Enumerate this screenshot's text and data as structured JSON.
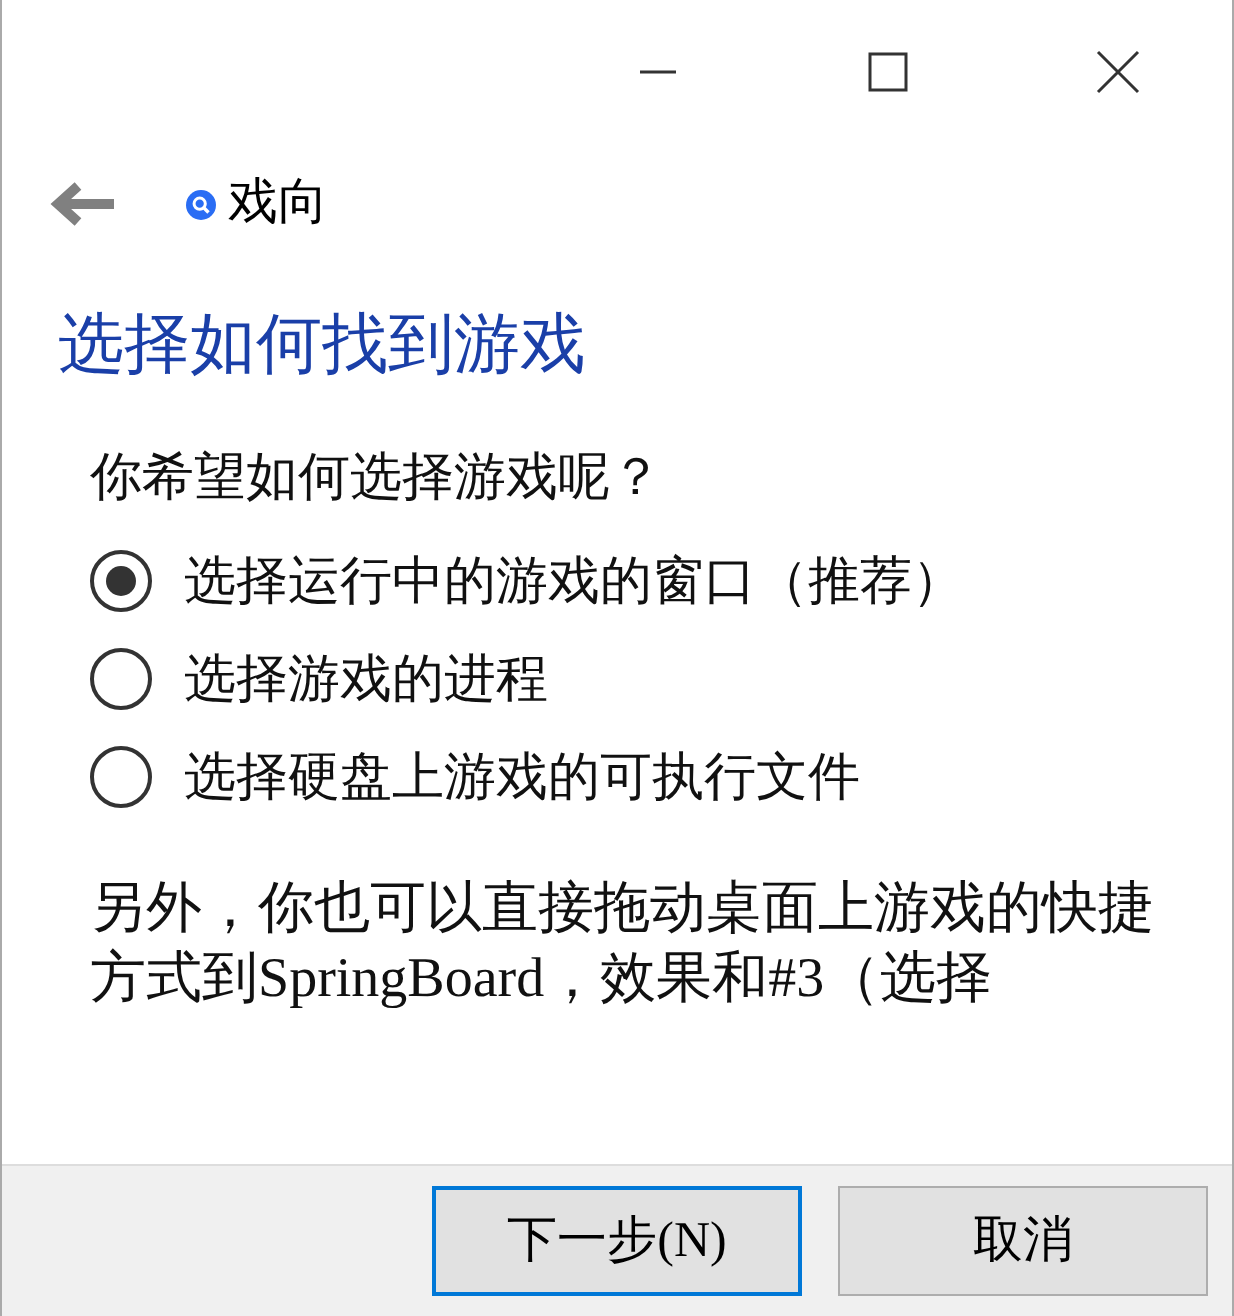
{
  "header": {
    "title": "戏向"
  },
  "heading": "选择如何找到游戏",
  "question": "你希望如何选择游戏呢？",
  "options": [
    {
      "label": "选择运行中的游戏的窗口（推荐）",
      "selected": true
    },
    {
      "label": "选择游戏的进程",
      "selected": false
    },
    {
      "label": "选择硬盘上游戏的可执行文件",
      "selected": false
    }
  ],
  "note": "另外，你也可以直接拖动桌面上游戏的快捷方式到SpringBoard，效果和#3（选择",
  "buttons": [
    {
      "label": "下一步(N)",
      "focused": true
    },
    {
      "label": "取消",
      "focused": false
    }
  ]
}
